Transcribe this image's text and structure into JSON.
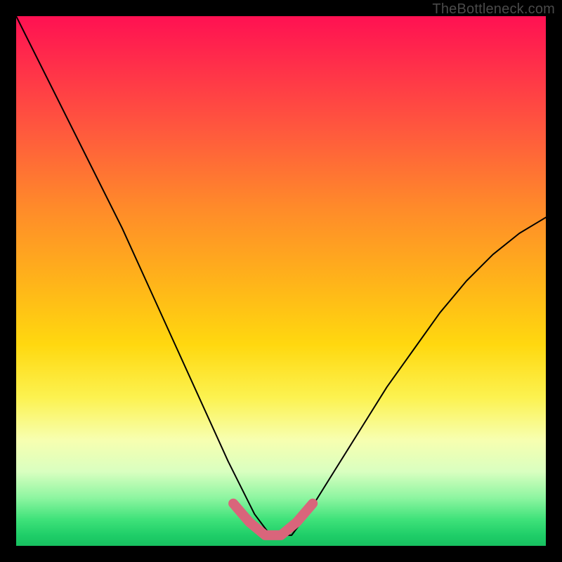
{
  "watermark": "TheBottleneck.com",
  "chart_data": {
    "type": "line",
    "title": "",
    "xlabel": "",
    "ylabel": "",
    "xlim": [
      0,
      100
    ],
    "ylim": [
      0,
      100
    ],
    "series": [
      {
        "name": "bottleneck-curve",
        "x": [
          0,
          5,
          10,
          15,
          20,
          25,
          30,
          35,
          40,
          45,
          48,
          52,
          55,
          60,
          65,
          70,
          75,
          80,
          85,
          90,
          95,
          100
        ],
        "values": [
          100,
          90,
          80,
          70,
          60,
          49,
          38,
          27,
          16,
          6,
          2,
          2,
          6,
          14,
          22,
          30,
          37,
          44,
          50,
          55,
          59,
          62
        ]
      },
      {
        "name": "highlight-segment",
        "x": [
          41,
          44,
          47,
          50,
          53,
          56
        ],
        "values": [
          8,
          4.5,
          2,
          2,
          4.5,
          8
        ]
      }
    ],
    "colors": {
      "curve": "#000000",
      "highlight": "#d9657b",
      "gradient_top": "#ff1152",
      "gradient_bottom": "#17c060"
    }
  }
}
